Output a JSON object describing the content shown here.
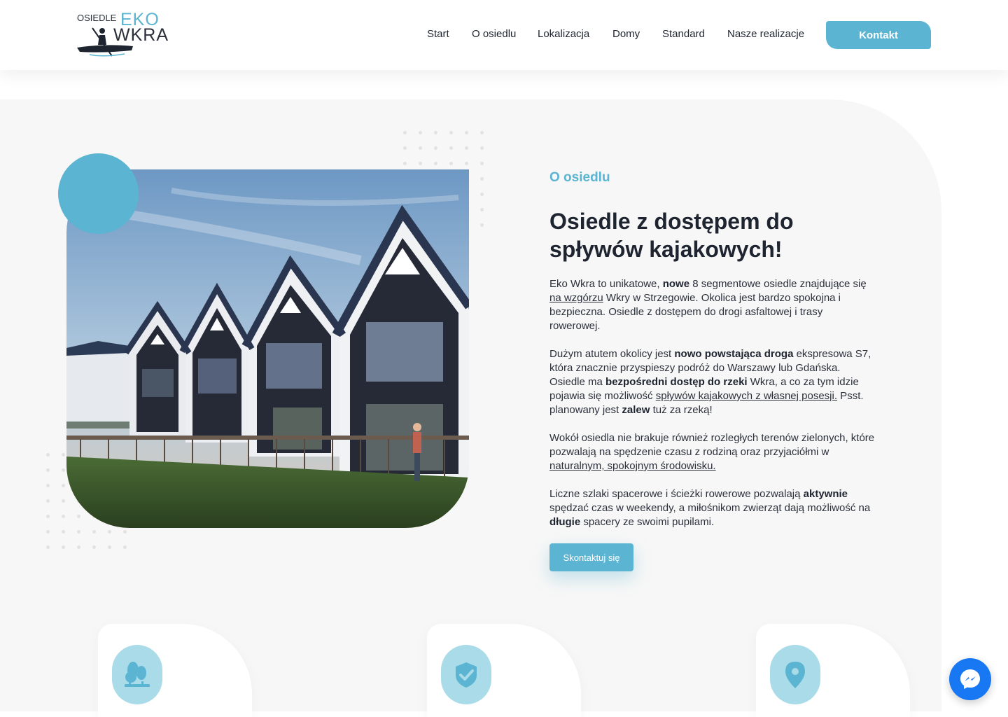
{
  "logo": {
    "small": "OSIEDLE",
    "eko": "EKO",
    "wkra": "WKRA"
  },
  "nav": {
    "items": [
      {
        "label": "Start"
      },
      {
        "label": "O osiedlu"
      },
      {
        "label": "Lokalizacja"
      },
      {
        "label": "Domy"
      },
      {
        "label": "Standard"
      },
      {
        "label": "Nasze realizacje"
      }
    ],
    "contact_label": "Kontakt"
  },
  "about": {
    "label": "O osiedlu",
    "title": "Osiedle z dostępem do spływów kajakowych!",
    "p1": {
      "a": "Eko Wkra to unikatowe, ",
      "b": "nowe",
      "c": " 8 segmentowe osiedle znajdujące się ",
      "link": "na wzgórzu",
      "d": " Wkry w Strzegowie. Okolica jest bardzo spokojna i bezpieczna. Osiedle z dostępem do drogi asfaltowej i trasy rowerowej."
    },
    "p2": {
      "a": "Dużym atutem okolicy jest ",
      "b": "nowo powstająca droga",
      "c": " ekspresowa S7, która znacznie przyspieszy podróż do Warszawy lub Gdańska. Osiedle ma ",
      "d": "bezpośredni dostęp do rzeki",
      "e": " Wkra, a co za tym idzie pojawia się możliwość ",
      "link": "spływów kajakowych z własnej posesji.",
      "f": " Psst. planowany jest ",
      "g": "zalew",
      "h": " tuż za rzeką!"
    },
    "p3": {
      "a": "Wokół osiedla nie brakuje również rozległych terenów zielonych, które pozwalają na spędzenie czasu z rodziną oraz przyjaciółmi w ",
      "link": "naturalnym, spokojnym środowisku."
    },
    "p4": {
      "a": "Liczne szlaki spacerowe i ścieżki rowerowe pozwalają ",
      "b": "aktywnie",
      "c": " spędzać czas w weekendy, a miłośnikom zwierząt dają możliwość na ",
      "d": "długie",
      "e": " spacery ze swoimi pupilami."
    },
    "cta_label": "Skontaktuj się"
  },
  "cards": [
    {
      "icon": "trees-icon"
    },
    {
      "icon": "shield-check-icon"
    },
    {
      "icon": "map-pin-icon"
    }
  ],
  "colors": {
    "accent": "#5bb4d1",
    "icon_bg": "#a9dbe9",
    "section_bg": "#f7f7f7",
    "messenger": "#1877f2"
  }
}
